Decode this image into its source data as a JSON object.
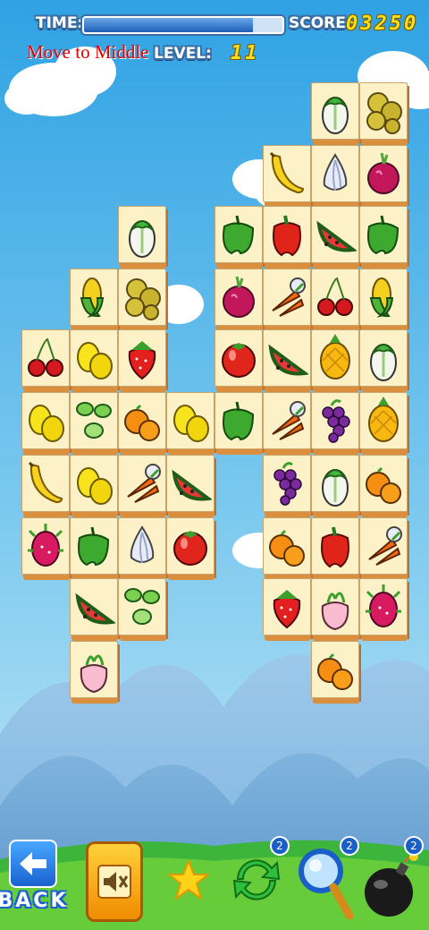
{
  "hud": {
    "time_label": "TIME:",
    "time_remaining": 0.85,
    "score_label": "SCORE:",
    "score_value": "03250",
    "level_label": "LEVEL:",
    "level_value": "11",
    "level_hint": "Move to Middle"
  },
  "colors": {
    "sky_top": "#39a8e6",
    "sky_bottom": "#bfe5f5",
    "tile_face": "#fdf1c8",
    "tile_edge": "#d98f3d",
    "hint_red": "#e00000",
    "score_yellow": "#f8e020"
  },
  "board": {
    "tiles": [
      {
        "fruit": "napa-cabbage"
      },
      {
        "fruit": "potatoes"
      },
      {
        "fruit": "banana"
      },
      {
        "fruit": "garlic"
      },
      {
        "fruit": "red-onion"
      },
      {
        "fruit": "napa-cabbage"
      },
      {
        "fruit": "green-pepper"
      },
      {
        "fruit": "red-pepper"
      },
      {
        "fruit": "watermelon"
      },
      {
        "fruit": "green-pepper"
      },
      {
        "fruit": "corn"
      },
      {
        "fruit": "potatoes"
      },
      {
        "fruit": "red-onion"
      },
      {
        "fruit": "carrots"
      },
      {
        "fruit": "cherries"
      },
      {
        "fruit": "corn"
      },
      {
        "fruit": "cherries"
      },
      {
        "fruit": "lemons"
      },
      {
        "fruit": "strawberry"
      },
      {
        "fruit": "tomato"
      },
      {
        "fruit": "watermelon"
      },
      {
        "fruit": "pineapple"
      },
      {
        "fruit": "napa-cabbage"
      },
      {
        "fruit": "lemons"
      },
      {
        "fruit": "cucumber"
      },
      {
        "fruit": "oranges"
      },
      {
        "fruit": "lemons"
      },
      {
        "fruit": "green-pepper"
      },
      {
        "fruit": "carrots"
      },
      {
        "fruit": "grapes"
      },
      {
        "fruit": "pineapple"
      },
      {
        "fruit": "banana"
      },
      {
        "fruit": "lemons"
      },
      {
        "fruit": "carrots"
      },
      {
        "fruit": "watermelon"
      },
      {
        "fruit": "grapes"
      },
      {
        "fruit": "napa-cabbage"
      },
      {
        "fruit": "oranges"
      },
      {
        "fruit": "dragon-fruit"
      },
      {
        "fruit": "green-pepper"
      },
      {
        "fruit": "garlic"
      },
      {
        "fruit": "tomato"
      },
      {
        "fruit": "oranges"
      },
      {
        "fruit": "red-pepper"
      },
      {
        "fruit": "carrots"
      },
      {
        "fruit": "watermelon"
      },
      {
        "fruit": "cucumber"
      },
      {
        "fruit": "strawberry"
      },
      {
        "fruit": "turnip"
      },
      {
        "fruit": "dragon-fruit"
      },
      {
        "fruit": "turnip"
      },
      {
        "fruit": "oranges"
      }
    ]
  },
  "toolbar": {
    "back_label": "BACK",
    "sound_icon": "speaker-muted-icon",
    "star_icon": "star-icon",
    "shuffle_icon": "shuffle-arrows-icon",
    "shuffle_count": "2",
    "hint_icon": "magnifier-icon",
    "hint_count": "2",
    "bomb_icon": "bomb-icon",
    "bomb_count": "2"
  }
}
